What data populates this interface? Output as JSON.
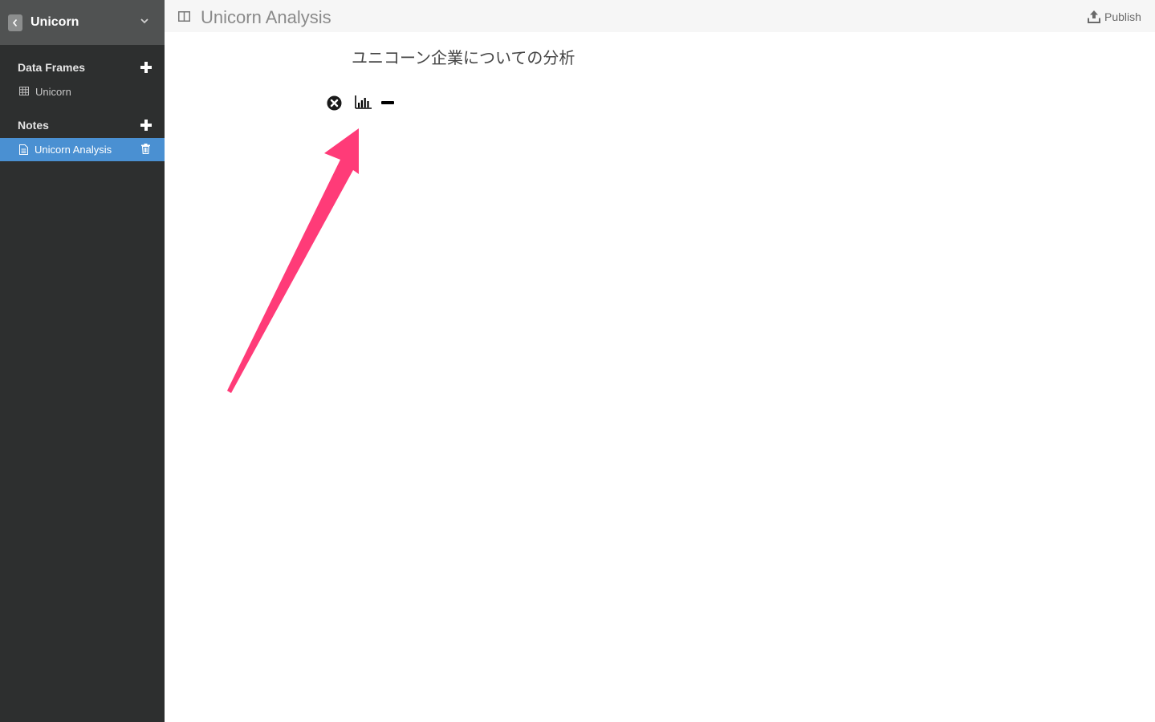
{
  "sidebar": {
    "project_title": "Unicorn",
    "sections": {
      "data_frames": {
        "title": "Data Frames",
        "items": [
          {
            "label": "Unicorn",
            "icon": "table-icon"
          }
        ]
      },
      "notes": {
        "title": "Notes",
        "items": [
          {
            "label": "Unicorn Analysis",
            "icon": "document-icon",
            "selected": true
          }
        ]
      }
    }
  },
  "topbar": {
    "title": "Unicorn Analysis",
    "publish_label": "Publish"
  },
  "note": {
    "text": "ユニコーン企業についての分析",
    "toolbar_icons": [
      "close-circle-icon",
      "bar-chart-icon",
      "minus-icon"
    ]
  },
  "colors": {
    "sidebar_bg": "#2d2f2f",
    "sidebar_header_bg": "#505252",
    "selected_bg": "#4a90d2",
    "annotation_arrow": "#ff3b78"
  }
}
